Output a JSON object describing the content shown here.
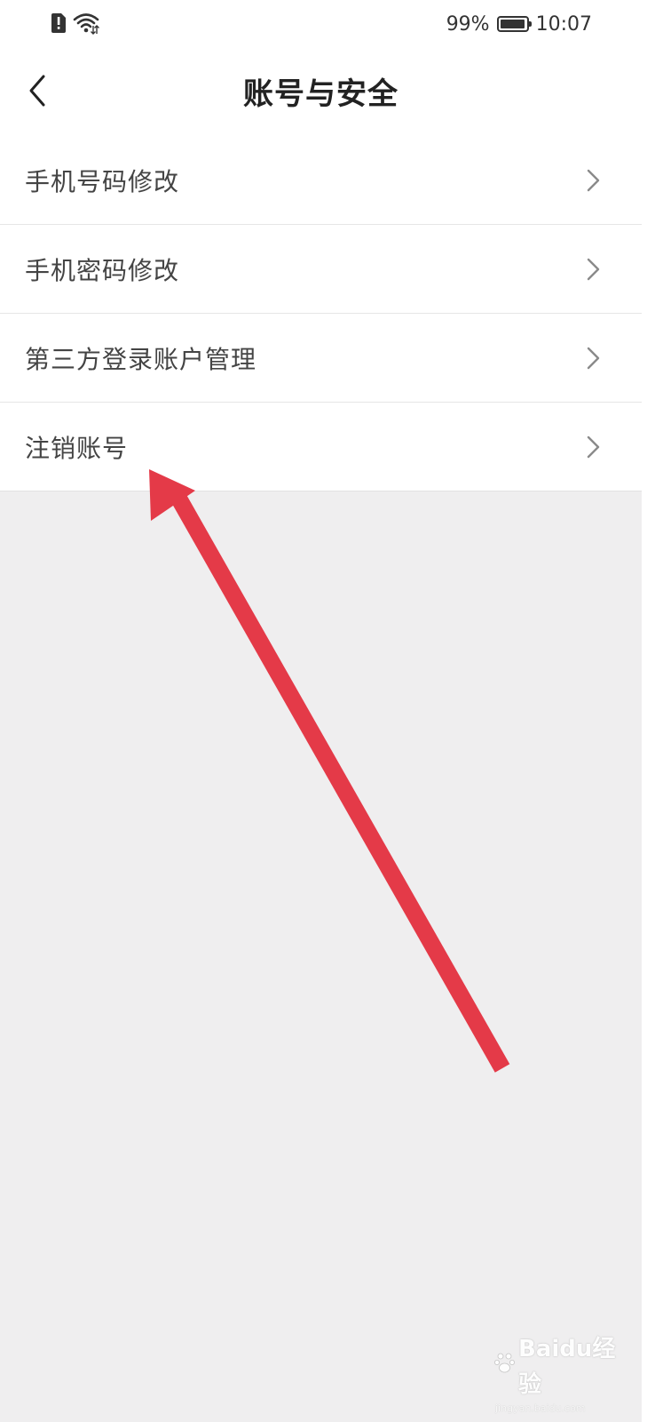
{
  "status_bar": {
    "battery_percent": "99%",
    "battery_level": 0.99,
    "time": "10:07",
    "icons": [
      "alert-sim-icon",
      "wifi-icon",
      "battery-icon"
    ]
  },
  "header": {
    "title": "账号与安全",
    "back_icon": "chevron-left-icon"
  },
  "menu": {
    "items": [
      {
        "label": "手机号码修改",
        "icon": "chevron-right-icon"
      },
      {
        "label": "手机密码修改",
        "icon": "chevron-right-icon"
      },
      {
        "label": "第三方登录账户管理",
        "icon": "chevron-right-icon"
      },
      {
        "label": "注销账号",
        "icon": "chevron-right-icon"
      }
    ]
  },
  "annotation": {
    "arrow_color": "#e43a48",
    "points_to": "注销账号"
  },
  "watermark": {
    "logo": "Baidu经验",
    "url": "jingyan.baidu.com"
  },
  "colors": {
    "background": "#efeeef",
    "surface": "#ffffff",
    "text_primary": "#222222",
    "text_item": "#444444",
    "divider": "#e6e6e6"
  }
}
